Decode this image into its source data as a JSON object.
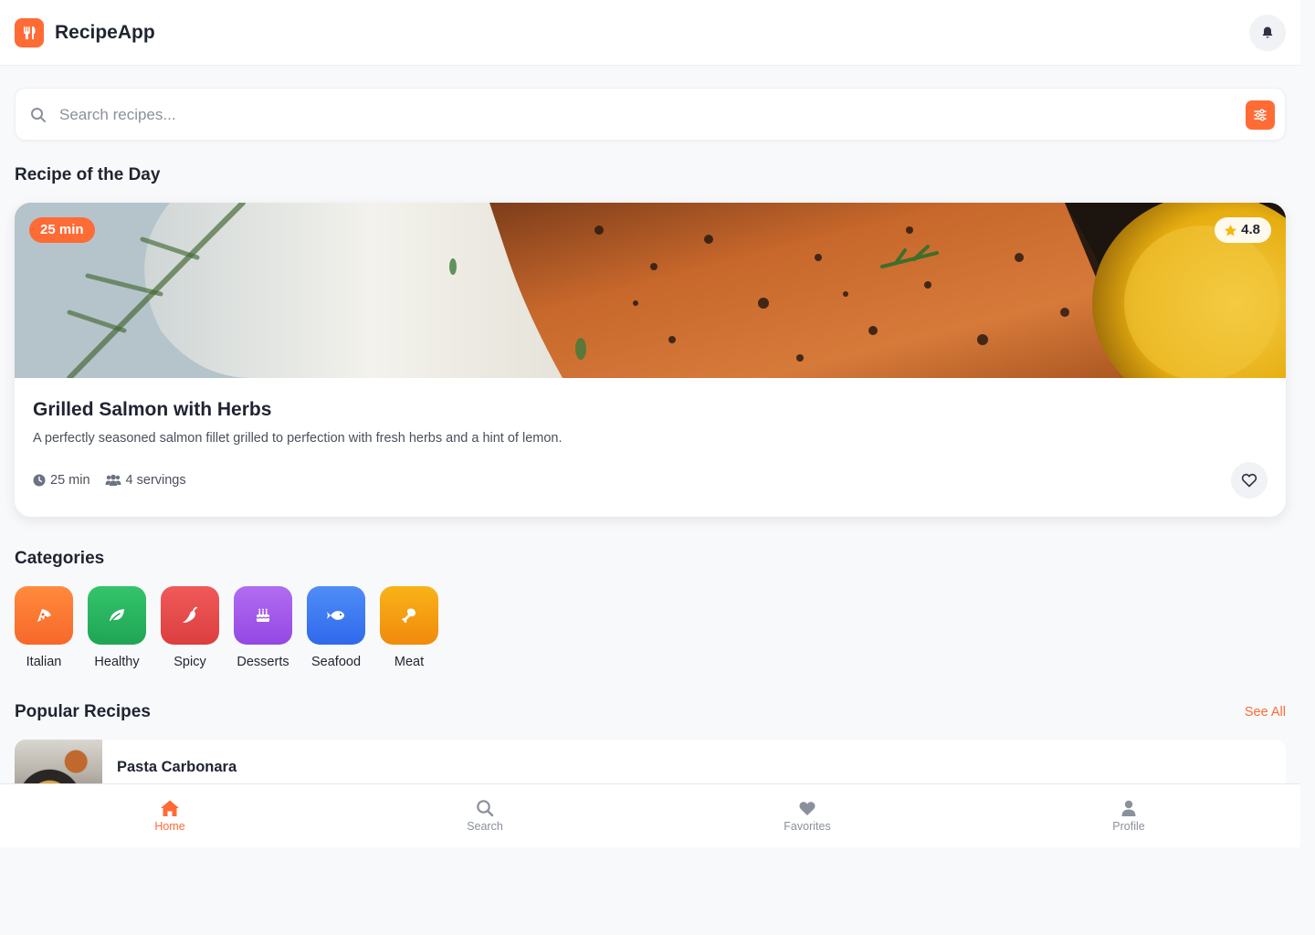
{
  "colors": {
    "accent": "#ff6b35",
    "nav_inactive": "#8a909c",
    "categories": {
      "italian": [
        "#ff8a3d",
        "#f7682a"
      ],
      "healthy": [
        "#34c46a",
        "#1fa555"
      ],
      "spicy": [
        "#f05a5a",
        "#dc3e3e"
      ],
      "desserts": [
        "#b26cf2",
        "#9448e3"
      ],
      "seafood": [
        "#4f8df7",
        "#3069ec"
      ],
      "meat": [
        "#f8b319",
        "#f18a0c"
      ]
    }
  },
  "header": {
    "app_name": "RecipeApp",
    "logo_icon": "utensils-icon",
    "notification_icon": "bell-icon"
  },
  "search": {
    "placeholder": "Search recipes...",
    "value": "",
    "filter_icon": "sliders-icon"
  },
  "featured": {
    "section_title": "Recipe of the Day",
    "time_badge": "25 min",
    "rating": "4.8",
    "title": "Grilled Salmon with Herbs",
    "description": "A perfectly seasoned salmon fillet grilled to perfection with fresh herbs and a hint of lemon.",
    "time": "25 min",
    "servings": "4 servings"
  },
  "categories": {
    "section_title": "Categories",
    "items": [
      {
        "label": "Italian",
        "icon": "pizza-icon"
      },
      {
        "label": "Healthy",
        "icon": "leaf-icon"
      },
      {
        "label": "Spicy",
        "icon": "pepper-icon"
      },
      {
        "label": "Desserts",
        "icon": "cake-icon"
      },
      {
        "label": "Seafood",
        "icon": "fish-icon"
      },
      {
        "label": "Meat",
        "icon": "drumstick-icon"
      }
    ]
  },
  "popular": {
    "section_title": "Popular Recipes",
    "see_all": "See All",
    "items": [
      {
        "title": "Pasta Carbonara"
      }
    ]
  },
  "bottom_nav": {
    "items": [
      {
        "label": "Home",
        "icon": "home-icon",
        "active": true
      },
      {
        "label": "Search",
        "icon": "search-icon",
        "active": false
      },
      {
        "label": "Favorites",
        "icon": "heart-icon",
        "active": false
      },
      {
        "label": "Profile",
        "icon": "user-icon",
        "active": false
      }
    ]
  }
}
